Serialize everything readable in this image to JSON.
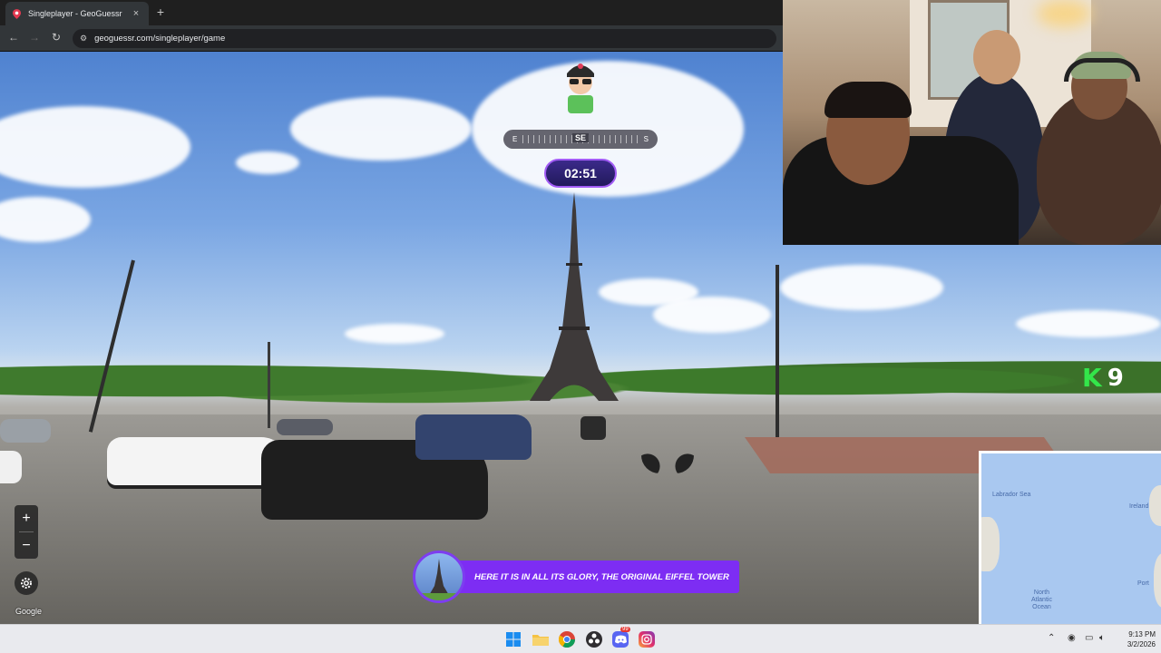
{
  "browser": {
    "tab_title": "Singleplayer - GeoGuessr",
    "tab_close": "×",
    "new_tab": "+",
    "url": "geoguessr.com/singleplayer/game",
    "back": "←",
    "forward": "→",
    "reload": "↻"
  },
  "game": {
    "compass": {
      "left": "E",
      "center": "SE",
      "right": "S"
    },
    "timer": "02:51",
    "subtitle": "HERE IT IS IN ALL ITS GLORY, THE ORIGINAL EIFFEL TOWER",
    "zoom_in": "+",
    "zoom_out": "−",
    "google_mark": "Google"
  },
  "overlay": {
    "logo_letter": "K",
    "logo_number": "9"
  },
  "map": {
    "labels": {
      "labrador": "Labrador Sea",
      "ireland": "Ireland",
      "atlantic": "North\nAtlantic\nOcean",
      "port": "Port"
    },
    "colors": {
      "water": "#a9c8f0",
      "land": "#e4e1d8"
    }
  },
  "taskbar": {
    "icons": [
      "windows-start-icon",
      "file-explorer-icon",
      "chrome-icon",
      "obs-icon",
      "discord-icon",
      "instagram-icon"
    ],
    "discord_badge": "99",
    "time": "9:13 PM",
    "date": "3/2/2026"
  },
  "colors": {
    "accent_purple": "#7d2df3",
    "timer_border": "#a25cf5",
    "k9_green": "#33e64a"
  }
}
